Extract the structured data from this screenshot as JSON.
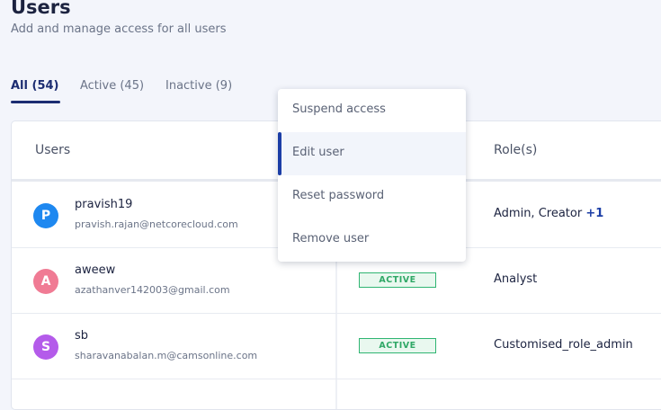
{
  "header": {
    "title": "Users",
    "subtitle": "Add and manage access for all users"
  },
  "tabs": [
    {
      "label": "All (54)",
      "active": true
    },
    {
      "label": "Active (45)",
      "active": false
    },
    {
      "label": "Inactive (9)",
      "active": false
    }
  ],
  "table": {
    "columns": {
      "users": "Users",
      "roles": "Role(s)"
    },
    "rows": [
      {
        "initial": "P",
        "avatar_color": "#1e88f0",
        "name": "pravish19",
        "email": "pravish.rajan@netcorecloud.com",
        "status": "",
        "role": "Admin, Creator",
        "role_more": "+1"
      },
      {
        "initial": "A",
        "avatar_color": "#f07b94",
        "name": "aweew",
        "email": "azathanver142003@gmail.com",
        "status": "ACTIVE",
        "role": "Analyst",
        "role_more": ""
      },
      {
        "initial": "S",
        "avatar_color": "#b45bea",
        "name": "sb",
        "email": "sharavanabalan.m@camsonline.com",
        "status": "ACTIVE",
        "role": "Customised_role_admin",
        "role_more": ""
      }
    ]
  },
  "context_menu": {
    "items": [
      "Suspend access",
      "Edit user",
      "Reset password",
      "Remove user"
    ],
    "highlighted": "Edit user"
  }
}
